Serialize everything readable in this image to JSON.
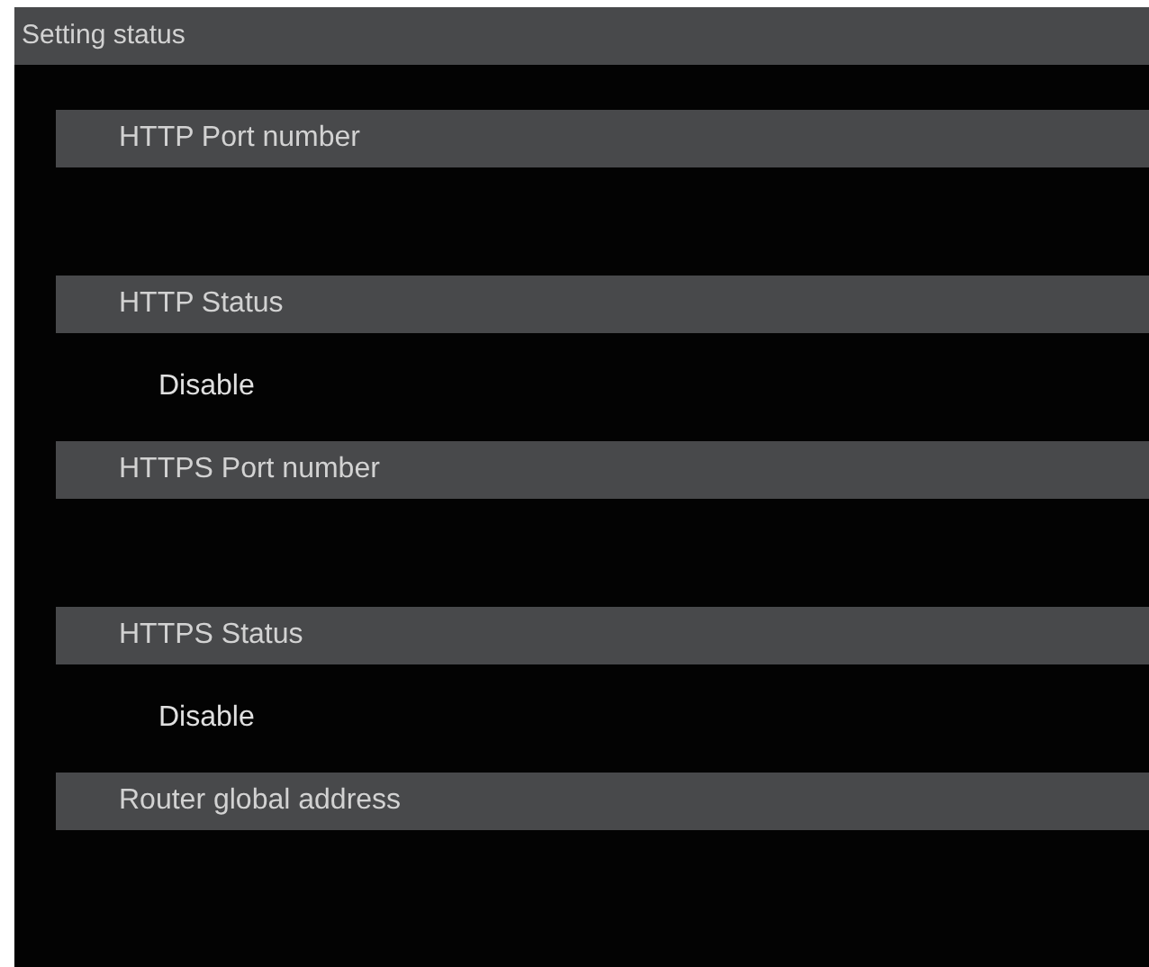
{
  "header": {
    "title": "Setting status"
  },
  "sections": [
    {
      "label": "HTTP Port number"
    },
    {
      "label": "HTTP Status",
      "value": "Disable"
    },
    {
      "label": "HTTPS Port number"
    },
    {
      "label": "HTTPS Status",
      "value": "Disable"
    },
    {
      "label": "Router global address"
    }
  ]
}
